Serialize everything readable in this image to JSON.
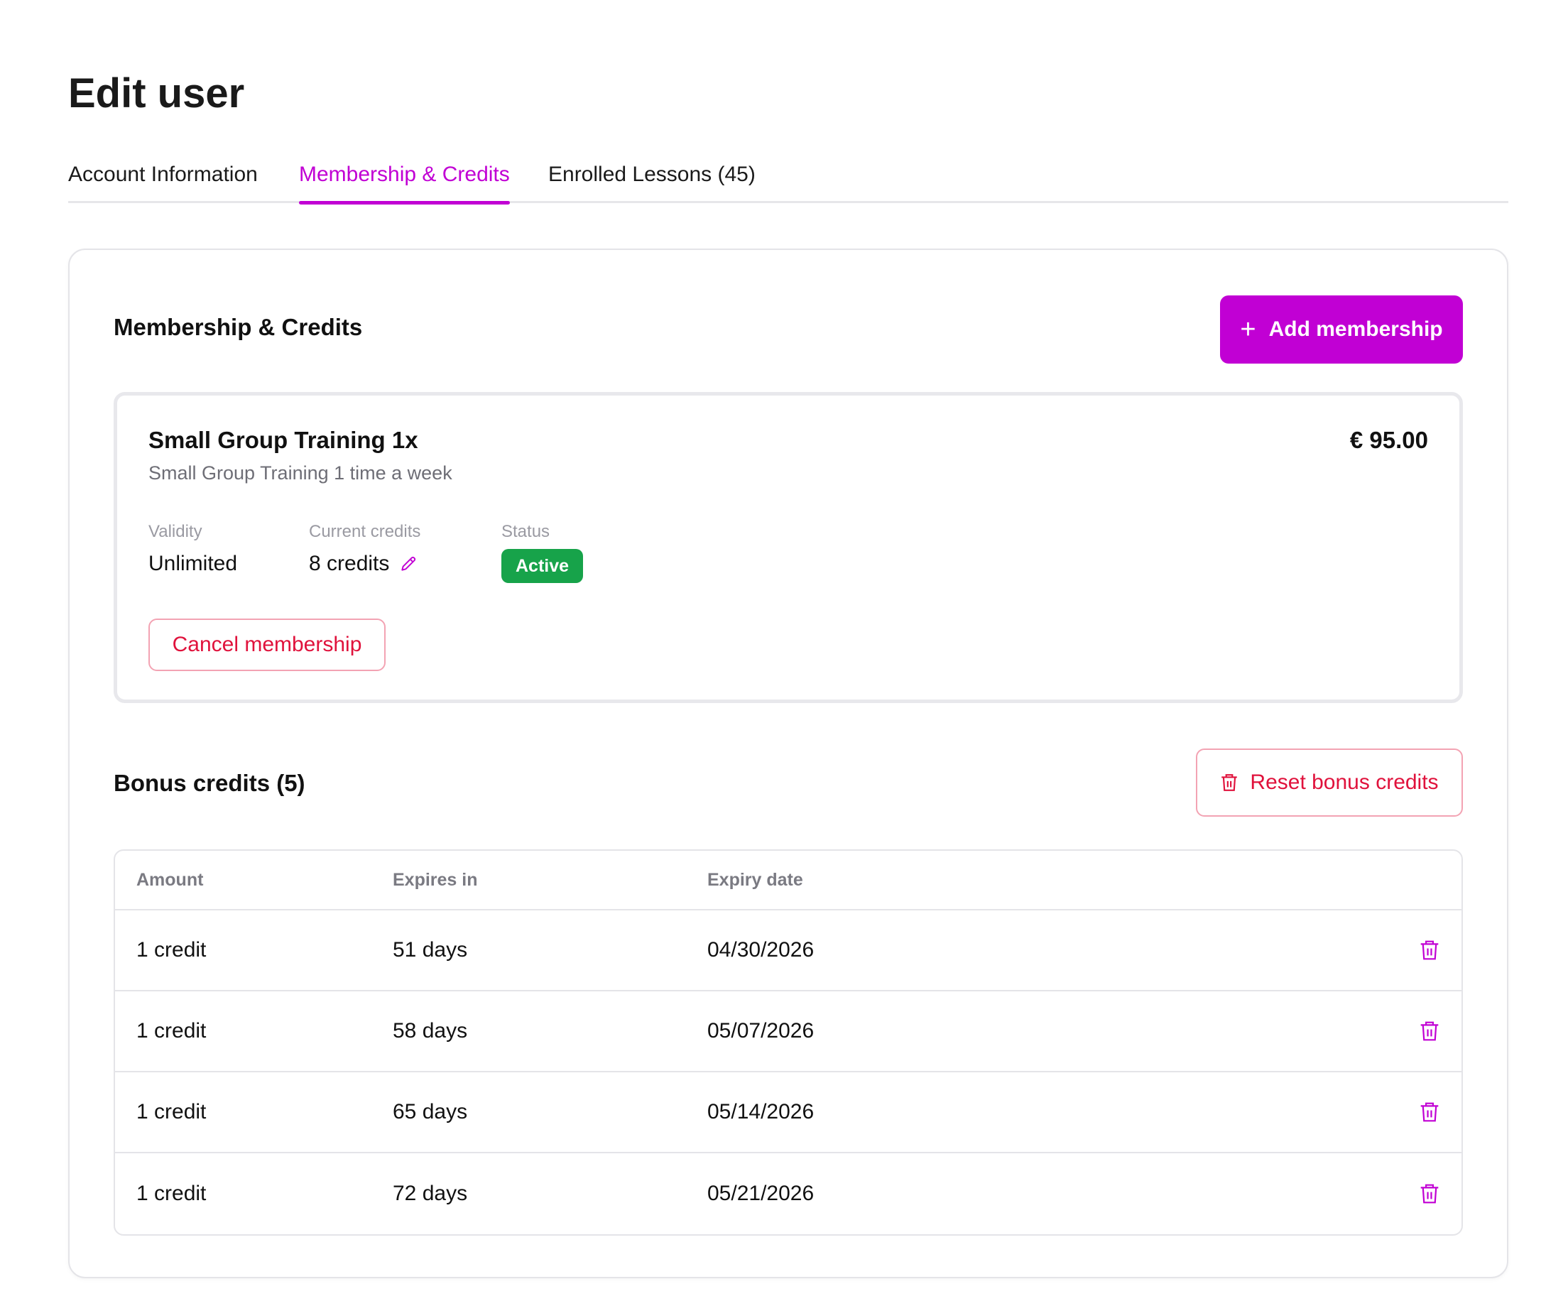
{
  "page": {
    "title": "Edit user"
  },
  "tabs": [
    {
      "label": "Account Information"
    },
    {
      "label": "Membership & Credits",
      "active": true
    },
    {
      "label": "Enrolled Lessons (45)"
    }
  ],
  "section": {
    "title": "Membership & Credits",
    "add_button": "Add membership"
  },
  "membership": {
    "name": "Small Group Training 1x",
    "description": "Small Group Training 1 time a week",
    "price": "€ 95.00",
    "validity_label": "Validity",
    "validity": "Unlimited",
    "credits_label": "Current credits",
    "credits": "8 credits",
    "status_label": "Status",
    "status": "Active",
    "cancel_button": "Cancel membership"
  },
  "bonus": {
    "title": "Bonus credits (5)",
    "reset_button": "Reset bonus credits",
    "columns": [
      "Amount",
      "Expires in",
      "Expiry date"
    ],
    "rows": [
      {
        "amount": "1 credit",
        "expires_in": "51 days",
        "expiry_date": "04/30/2026"
      },
      {
        "amount": "1 credit",
        "expires_in": "58 days",
        "expiry_date": "05/07/2026"
      },
      {
        "amount": "1 credit",
        "expires_in": "65 days",
        "expiry_date": "05/14/2026"
      },
      {
        "amount": "1 credit",
        "expires_in": "72 days",
        "expiry_date": "05/21/2026"
      }
    ]
  },
  "colors": {
    "accent": "#c100d4",
    "danger": "#e0123c",
    "success": "#17a34a"
  }
}
